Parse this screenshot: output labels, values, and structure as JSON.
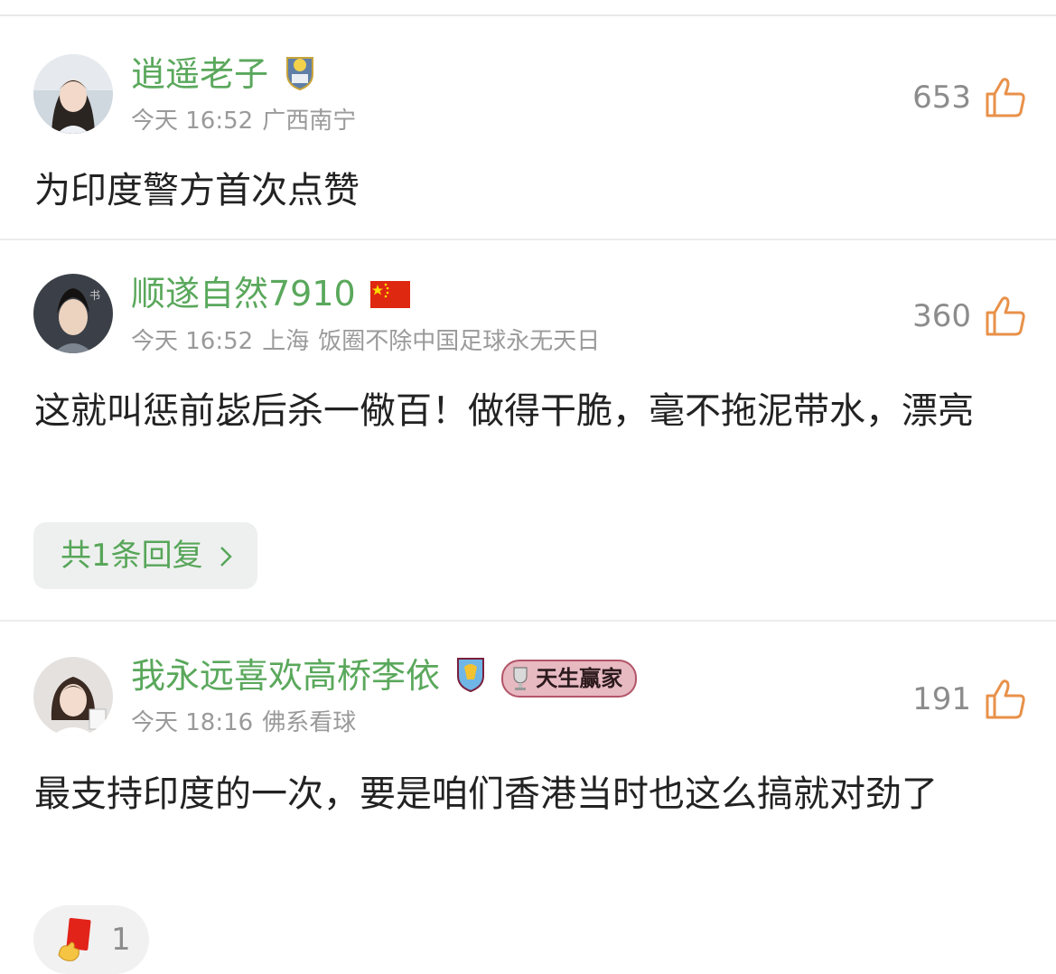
{
  "colors": {
    "name_green": "#5aa85c",
    "like_orange": "#e8914a",
    "meta_gray": "#9a9a9a"
  },
  "comments": [
    {
      "username": "逍遥老子",
      "badge_icon": "team-crest-icon",
      "time": "今天 16:52",
      "location": "广西南宁",
      "likes": "653",
      "text": "为印度警方首次点赞"
    },
    {
      "username": "顺遂自然7910",
      "badge_icon": "china-flag-icon",
      "time": "今天 16:52",
      "location": "上海",
      "tagline": "饭圈不除中国足球永无天日",
      "likes": "360",
      "text": "这就叫惩前毖后杀一儆百！做得干脆，毫不拖泥带水，漂亮",
      "replies_label": "共1条回复"
    },
    {
      "username": "我永远喜欢高桥李依",
      "badge_icon": "aston-villa-crest-icon",
      "title_badge": "天生赢家",
      "time": "今天 18:16",
      "location": "佛系看球",
      "likes": "191",
      "text": "最支持印度的一次，要是咱们香港当时也这么搞就对劲了",
      "reaction_icon": "red-card-icon",
      "reaction_count": "1"
    }
  ]
}
